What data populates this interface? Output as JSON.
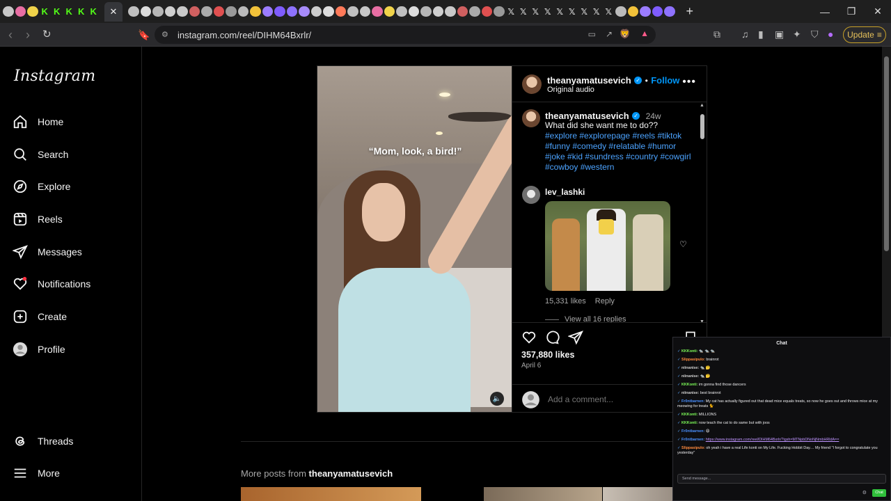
{
  "browser": {
    "url": "instagram.com/reel/DIHM64Bxrlr/",
    "update_label": "Update",
    "tabs_icon_names": [
      "tab-favicon"
    ],
    "new_tab": "+",
    "window_controls": [
      "—",
      "❐",
      "✕"
    ]
  },
  "sidebar": {
    "logo": "Instagram",
    "items": [
      {
        "label": "Home",
        "icon": "home-icon"
      },
      {
        "label": "Search",
        "icon": "search-icon"
      },
      {
        "label": "Explore",
        "icon": "compass-icon"
      },
      {
        "label": "Reels",
        "icon": "reels-icon"
      },
      {
        "label": "Messages",
        "icon": "messages-icon"
      },
      {
        "label": "Notifications",
        "icon": "heart-icon"
      },
      {
        "label": "Create",
        "icon": "plus-icon"
      },
      {
        "label": "Profile",
        "icon": "avatar"
      },
      {
        "label": "Threads",
        "icon": "threads-icon"
      },
      {
        "label": "More",
        "icon": "menu-icon"
      }
    ]
  },
  "post": {
    "video_caption": "“Mom, look, a bird!”",
    "author": "theanyamatusevich",
    "follow": "Follow",
    "audio": "Original audio",
    "caption_user": "theanyamatusevich",
    "caption_age": "24w",
    "caption_text": "What did she want me to do??",
    "hashtags": [
      "#explore",
      "#explorepage",
      "#reels",
      "#tiktok",
      "#funny",
      "#comedy",
      "#relatable",
      "#humor",
      "#joke",
      "#kid",
      "#sundress",
      "#country",
      "#cowgirl",
      "#cowboy",
      "#western"
    ],
    "comment_user": "lev_lashki",
    "comment_likes": "15,331 likes",
    "comment_reply": "Reply",
    "view_replies": "View all 16 replies",
    "likes": "357,880 likes",
    "date": "April 6",
    "add_comment_placeholder": "Add a comment..."
  },
  "more_posts": {
    "prefix": "More posts from",
    "user": "theanyamatusevich"
  },
  "chat": {
    "title": "Chat",
    "messages": [
      {
        "user": "KKKonti:",
        "user_color": "#7fff5a",
        "text": "🐀 🐀 🐀"
      },
      {
        "user": "Slippasipulo:",
        "user_color": "#ff8a3d",
        "text": "brainrot"
      },
      {
        "user": "niinanise:",
        "user_color": "#d0d0d0",
        "text": "🐀 🤔"
      },
      {
        "user": "niinanise:",
        "user_color": "#d0d0d0",
        "text": "🐀 🤔"
      },
      {
        "user": "KKKonti:",
        "user_color": "#7fff5a",
        "text": "im gonna find those dancers"
      },
      {
        "user": "niinanise:",
        "user_color": "#d0d0d0",
        "text": "best brainrot"
      },
      {
        "user": "Fr0ntbarnen:",
        "user_color": "#4a90ff",
        "text": "My cat has actually figured out that dead mice equals treats, so now he goes out and throws mice at my meowing for treats 🐈"
      },
      {
        "user": "KKKonti:",
        "user_color": "#7fff5a",
        "text": "MILLIONS"
      },
      {
        "user": "KKKonti:",
        "user_color": "#7fff5a",
        "text": "now teach the cat to do same but with joos"
      },
      {
        "user": "Fr0ntbarnen:",
        "user_color": "#4a90ff",
        "text": "😄"
      },
      {
        "user": "Fr0ntbarnen:",
        "user_color": "#4a90ff",
        "text": "https://www.instagram.com/reel/DIHM64Bxrlr/?igsh=MTNpbDNoNjNmbHRldA=="
      },
      {
        "user": "Slippasipulo:",
        "user_color": "#ff8a3d",
        "text": "oh yeah i have a real Life konti on My Life. Fucking Hobbit Day.... My friend \"I forgot to congratulate you yesterday\""
      }
    ],
    "input_placeholder": "Send message...",
    "send_label": "Chat"
  }
}
